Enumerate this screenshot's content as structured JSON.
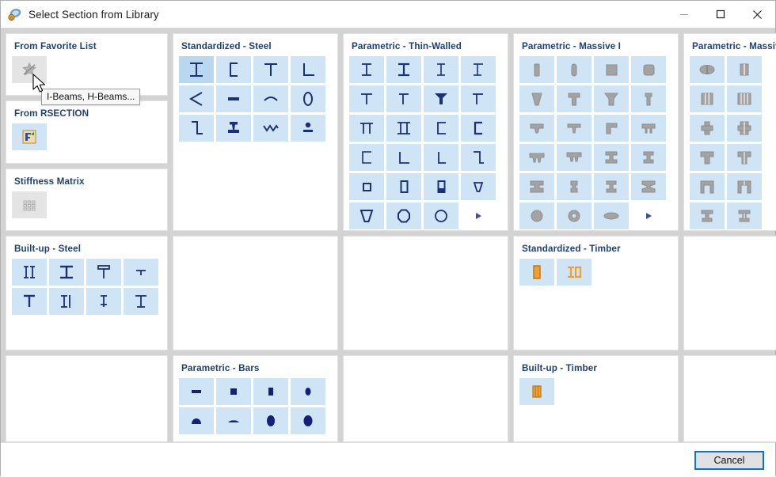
{
  "window": {
    "title": "Select Section from Library",
    "icon": "library-section-icon",
    "controls": [
      {
        "name": "minimize-button",
        "glyph": "minimize-icon"
      },
      {
        "name": "maximize-button",
        "glyph": "maximize-icon"
      },
      {
        "name": "close-button",
        "glyph": "close-icon"
      }
    ]
  },
  "tooltip": {
    "text": "I-Beams, H-Beams...",
    "visible": true
  },
  "cursor": {
    "visible": true
  },
  "colors": {
    "tile_bg": "#cfe4f5",
    "tile_hover_bg": "#b9d7ef",
    "tile_grey_bg": "#e4e4e4",
    "panel_title": "#1f3f77",
    "icon_steel": "#1c2f7a",
    "icon_massive": "#9a9a9a",
    "icon_timber": "#f0a030",
    "accent": "#0a74d1",
    "window_bg": "#d3d3d3"
  },
  "panels": [
    {
      "id": "standardized-steel",
      "title": "Standardized - Steel",
      "style": "steel",
      "tiles": [
        {
          "name": "section-i-beam",
          "shape": "i-beam",
          "state": "hover"
        },
        {
          "name": "section-channel",
          "shape": "channel"
        },
        {
          "name": "section-t-section",
          "shape": "t-section"
        },
        {
          "name": "section-angle-l",
          "shape": "angle-l"
        },
        {
          "name": "section-angle-acute",
          "shape": "angle-acute"
        },
        {
          "name": "section-flat-bar",
          "shape": "flat-bar"
        },
        {
          "name": "section-rolled-plate",
          "shape": "rolled-plate"
        },
        {
          "name": "section-round-hollow",
          "shape": "round-hollow"
        },
        {
          "name": "section-z-section",
          "shape": "z-section"
        },
        {
          "name": "section-rail",
          "shape": "rail"
        },
        {
          "name": "section-corrugated",
          "shape": "corrugated"
        },
        {
          "name": "section-bulb-flat",
          "shape": "bulb-flat"
        }
      ]
    },
    {
      "id": "parametric-thin-walled",
      "title": "Parametric - Thin-Walled",
      "style": "steel",
      "tiles": [
        {
          "name": "section-tw-i-1",
          "shape": "i-beam"
        },
        {
          "name": "section-tw-i-2",
          "shape": "i-beam-2"
        },
        {
          "name": "section-tw-i-3",
          "shape": "i-beam-3"
        },
        {
          "name": "section-tw-i-4",
          "shape": "i-beam-4"
        },
        {
          "name": "section-tw-t-1",
          "shape": "t-section"
        },
        {
          "name": "section-tw-t-2",
          "shape": "t-section-2"
        },
        {
          "name": "section-tw-t-3",
          "shape": "t-section-3"
        },
        {
          "name": "section-tw-t-4",
          "shape": "t-section-4"
        },
        {
          "name": "section-tw-pi",
          "shape": "pi-section"
        },
        {
          "name": "section-tw-double-i",
          "shape": "double-i"
        },
        {
          "name": "section-tw-channel-1",
          "shape": "channel"
        },
        {
          "name": "section-tw-channel-2",
          "shape": "channel-2"
        },
        {
          "name": "section-tw-channel-3",
          "shape": "channel-3"
        },
        {
          "name": "section-tw-angle-1",
          "shape": "angle-l"
        },
        {
          "name": "section-tw-angle-2",
          "shape": "angle-l2"
        },
        {
          "name": "section-tw-z",
          "shape": "z-section"
        },
        {
          "name": "section-tw-square-hollow",
          "shape": "square-hollow"
        },
        {
          "name": "section-tw-rect-hollow",
          "shape": "rect-hollow"
        },
        {
          "name": "section-tw-rect-hollow-2",
          "shape": "rect-hollow-2"
        },
        {
          "name": "section-tw-trapezoid-1",
          "shape": "trapezoid-small"
        },
        {
          "name": "section-tw-trapezoid-2",
          "shape": "trapezoid"
        },
        {
          "name": "section-tw-octagon",
          "shape": "octagon"
        },
        {
          "name": "section-tw-circle",
          "shape": "circle-hollow"
        },
        {
          "name": "section-tw-more",
          "shape": "more-arrow",
          "state": "plain"
        }
      ]
    },
    {
      "id": "parametric-massive-i",
      "title": "Parametric - Massive I",
      "style": "massive",
      "tiles": [
        {
          "name": "section-m-rect-1",
          "shape": "m-rect-narrow"
        },
        {
          "name": "section-m-rect-2",
          "shape": "m-rect-narrow2"
        },
        {
          "name": "section-m-square-1",
          "shape": "m-square"
        },
        {
          "name": "section-m-square-2",
          "shape": "m-square-round"
        },
        {
          "name": "section-m-taper-1",
          "shape": "m-taper"
        },
        {
          "name": "section-m-tee-1",
          "shape": "m-tee"
        },
        {
          "name": "section-m-tee-2",
          "shape": "m-tee-flared"
        },
        {
          "name": "section-m-tee-3",
          "shape": "m-tee-narrow"
        },
        {
          "name": "section-m-inv-tee-1",
          "shape": "m-inv-tee"
        },
        {
          "name": "section-m-inv-tee-2",
          "shape": "m-inv-tee-2"
        },
        {
          "name": "section-m-l-massive",
          "shape": "m-l"
        },
        {
          "name": "section-m-twin-leg-1",
          "shape": "m-twin-leg"
        },
        {
          "name": "section-m-twin-leg-2",
          "shape": "m-twin-leg-2"
        },
        {
          "name": "section-m-triple-leg",
          "shape": "m-triple-leg"
        },
        {
          "name": "section-m-i-1",
          "shape": "m-i"
        },
        {
          "name": "section-m-i-2",
          "shape": "m-i-2"
        },
        {
          "name": "section-m-i-3",
          "shape": "m-i-3"
        },
        {
          "name": "section-m-i-4",
          "shape": "m-i-4"
        },
        {
          "name": "section-m-i-5",
          "shape": "m-i-5"
        },
        {
          "name": "section-m-i-6",
          "shape": "m-i-6"
        },
        {
          "name": "section-m-circle",
          "shape": "m-circle"
        },
        {
          "name": "section-m-ring",
          "shape": "m-ring"
        },
        {
          "name": "section-m-ellipse",
          "shape": "m-ellipse"
        },
        {
          "name": "section-m-more",
          "shape": "more-arrow",
          "state": "plain"
        }
      ]
    },
    {
      "id": "parametric-massive-ii",
      "title": "Parametric - Massive II",
      "style": "massive",
      "tiles": [
        {
          "name": "section-m2-barrel",
          "shape": "m2-barrel"
        },
        {
          "name": "section-m2-two-cells",
          "shape": "m2-cells2"
        },
        {
          "name": "section-m2-three-cells",
          "shape": "m2-cells3"
        },
        {
          "name": "section-m2-four-cells",
          "shape": "m2-cells4"
        },
        {
          "name": "section-m2-cross-1",
          "shape": "m2-cross"
        },
        {
          "name": "section-m2-cross-2",
          "shape": "m2-cross2"
        },
        {
          "name": "section-m2-tee-1",
          "shape": "m2-tee"
        },
        {
          "name": "section-m2-tee-2",
          "shape": "m2-tee2"
        },
        {
          "name": "section-m2-arch-1",
          "shape": "m2-arch"
        },
        {
          "name": "section-m2-arch-2",
          "shape": "m2-arch2"
        },
        {
          "name": "section-m2-i-1",
          "shape": "m2-i"
        },
        {
          "name": "section-m2-i-2",
          "shape": "m2-i2"
        },
        {
          "name": "section-m2-i-3",
          "shape": "m2-i3"
        },
        {
          "name": "section-m2-i-4",
          "shape": "m2-i4"
        },
        {
          "name": "section-m2-box-1",
          "shape": "m2-box"
        },
        {
          "name": "section-m2-box-2",
          "shape": "m2-box2"
        },
        {
          "name": "section-m2-box-3",
          "shape": "m2-box3"
        },
        {
          "name": "section-m2-box-4",
          "shape": "m2-box4"
        },
        {
          "name": "section-m2-quad-1",
          "shape": "m2-quad"
        },
        {
          "name": "section-m2-quad-2",
          "shape": "m2-quad2"
        },
        {
          "name": "section-m2-i-5",
          "shape": "m2-i5"
        },
        {
          "name": "section-m2-stack-1",
          "shape": "m2-stack"
        },
        {
          "name": "section-m2-stack-2",
          "shape": "m2-stack2"
        }
      ]
    },
    {
      "id": "built-up-steel",
      "title": "Built-up - Steel",
      "style": "steel",
      "tiles": [
        {
          "name": "section-bu-double-i",
          "shape": "bu-double-i"
        },
        {
          "name": "section-bu-i-wide",
          "shape": "bu-i-wide"
        },
        {
          "name": "section-bu-t-plate",
          "shape": "bu-t-plate"
        },
        {
          "name": "section-bu-small-t",
          "shape": "bu-small-t"
        },
        {
          "name": "section-bu-t-1",
          "shape": "bu-t"
        },
        {
          "name": "section-bu-i-channel",
          "shape": "bu-i-channel"
        },
        {
          "name": "section-bu-i-narrow",
          "shape": "bu-i-narrow"
        },
        {
          "name": "section-bu-i-plain",
          "shape": "bu-i-plain"
        }
      ]
    },
    {
      "id": "standardized-timber",
      "title": "Standardized - Timber",
      "style": "timber",
      "tiles": [
        {
          "name": "section-timber-rect",
          "shape": "tb-rect"
        },
        {
          "name": "section-timber-i",
          "shape": "tb-i"
        }
      ]
    },
    {
      "id": "parametric-bars",
      "title": "Parametric - Bars",
      "style": "steel",
      "tiles": [
        {
          "name": "section-bar-flat",
          "shape": "bar-flat"
        },
        {
          "name": "section-bar-square",
          "shape": "bar-square"
        },
        {
          "name": "section-bar-rect",
          "shape": "bar-rect"
        },
        {
          "name": "section-bar-small-circle",
          "shape": "bar-small-circle"
        },
        {
          "name": "section-bar-half-round",
          "shape": "bar-half-round"
        },
        {
          "name": "section-bar-segment",
          "shape": "bar-segment"
        },
        {
          "name": "section-bar-oval",
          "shape": "bar-oval"
        },
        {
          "name": "section-bar-circle",
          "shape": "bar-circle"
        }
      ]
    },
    {
      "id": "built-up-timber",
      "title": "Built-up - Timber",
      "style": "timber",
      "tiles": [
        {
          "name": "section-timber-glulam",
          "shape": "tb-glulam"
        }
      ]
    }
  ],
  "side_panels": [
    {
      "id": "from-favorite-list",
      "title": "From Favorite List",
      "tile": {
        "name": "favorite-star-icon",
        "shape": "fav-star",
        "state": "grey"
      }
    },
    {
      "id": "from-rsection",
      "title": "From RSECTION",
      "tile": {
        "name": "rsection-icon",
        "shape": "rsection",
        "state": "normal"
      }
    },
    {
      "id": "stiffness-matrix",
      "title": "Stiffness Matrix",
      "tile": {
        "name": "stiffness-matrix-icon",
        "shape": "matrix",
        "state": "grey"
      }
    }
  ],
  "footer": {
    "cancel_label": "Cancel"
  }
}
